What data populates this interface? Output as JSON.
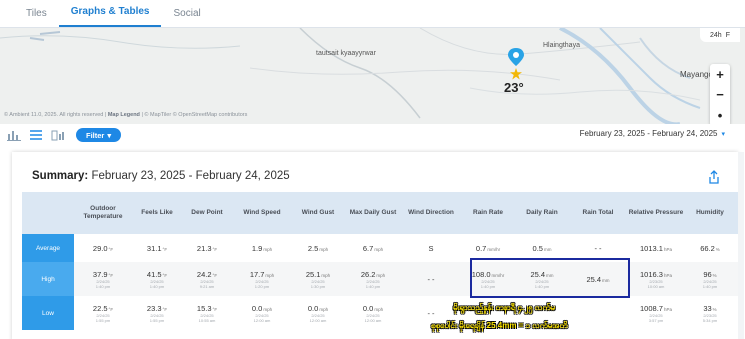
{
  "tabs": [
    {
      "label": "Tiles",
      "active": false
    },
    {
      "label": "Graphs & Tables",
      "active": true
    },
    {
      "label": "Social",
      "active": false
    }
  ],
  "map": {
    "labels": {
      "tautsait": "tautsait kyaayyrwar",
      "hlaingthaya": "Hlaingthaya",
      "mayangon": "Mayangc"
    },
    "temperature": "23°",
    "attribution_prefix": "© Ambient 11.0, 2025. All rights reserved |",
    "attribution_link": "Map Legend",
    "attribution_suffix": "| © MapTiler © OpenStreetMap contributors",
    "zoom_top": [
      "24h",
      "F"
    ],
    "zoom_controls": [
      "+",
      "−",
      "•"
    ]
  },
  "toolbar": {
    "filter_label": "Filter",
    "date_range": "February 23, 2025 - February 24, 2025"
  },
  "summary": {
    "title_bold": "Summary:",
    "title_rest": "February 23, 2025 - February 24, 2025"
  },
  "table": {
    "headers": [
      "",
      "Outdoor Temperature",
      "Feels Like",
      "Dew Point",
      "Wind Speed",
      "Wind Gust",
      "Max Daily Gust",
      "Wind Direction",
      "Rain Rate",
      "Daily Rain",
      "Rain Total",
      "Relative Pressure",
      "Humidity"
    ],
    "rows": [
      {
        "label": "Average",
        "cells": [
          {
            "value": "29.0",
            "unit": "°F"
          },
          {
            "value": "31.1",
            "unit": "°F"
          },
          {
            "value": "21.3",
            "unit": "°F"
          },
          {
            "value": "1.9",
            "unit": "mph"
          },
          {
            "value": "2.5",
            "unit": "mph"
          },
          {
            "value": "6.7",
            "unit": "mph"
          },
          {
            "value": "S",
            "unit": ""
          },
          {
            "value": "0.7",
            "unit": "mm/hr"
          },
          {
            "value": "0.5",
            "unit": "mm"
          },
          {
            "value": "- -",
            "unit": ""
          },
          {
            "value": "1013.1",
            "unit": "hPa"
          },
          {
            "value": "66.2",
            "unit": "%"
          }
        ]
      },
      {
        "label": "High",
        "cells": [
          {
            "value": "37.9",
            "unit": "°F",
            "d": "2/24/25",
            "t": "1:40 pm"
          },
          {
            "value": "41.5",
            "unit": "°F",
            "d": "2/24/25",
            "t": "1:40 pm"
          },
          {
            "value": "24.2",
            "unit": "°F",
            "d": "2/24/25",
            "t": "9:21 am"
          },
          {
            "value": "17.7",
            "unit": "mph",
            "d": "2/24/25",
            "t": "1:20 pm"
          },
          {
            "value": "25.1",
            "unit": "mph",
            "d": "2/24/25",
            "t": "1:30 pm"
          },
          {
            "value": "26.2",
            "unit": "mph",
            "d": "2/24/25",
            "t": "1:40 pm"
          },
          {
            "value": "- -",
            "unit": ""
          },
          {
            "value": "108.0",
            "unit": "mm/hr",
            "d": "2/24/25",
            "t": "1:40 pm"
          },
          {
            "value": "25.4",
            "unit": "mm",
            "d": "2/24/25",
            "t": "1:40 pm"
          },
          {
            "value": "25.4",
            "unit": "mm"
          },
          {
            "value": "1016.3",
            "unit": "hPa",
            "d": "2/23/25",
            "t": "10:00 am"
          },
          {
            "value": "96",
            "unit": "%",
            "d": "2/24/25",
            "t": "1:40 pm"
          }
        ]
      },
      {
        "label": "Low",
        "cells": [
          {
            "value": "22.5",
            "unit": "°F",
            "d": "2/24/25",
            "t": "1:55 pm"
          },
          {
            "value": "23.3",
            "unit": "°F",
            "d": "2/24/25",
            "t": "1:55 pm"
          },
          {
            "value": "15.3",
            "unit": "°F",
            "d": "2/24/25",
            "t": "10:55 am"
          },
          {
            "value": "0.0",
            "unit": "mph",
            "d": "2/24/25",
            "t": "12:00 am"
          },
          {
            "value": "0.0",
            "unit": "mph",
            "d": "2/24/25",
            "t": "12:00 am"
          },
          {
            "value": "0.0",
            "unit": "mph",
            "d": "2/24/25",
            "t": "12:00 am"
          },
          {
            "value": "- -",
            "unit": ""
          },
          {
            "value": "",
            "unit": ""
          },
          {
            "value": "",
            "unit": ""
          },
          {
            "value": "",
            "unit": ""
          },
          {
            "value": "1008.7",
            "unit": "hPa",
            "d": "2/24/25",
            "t": "3:57 pm"
          },
          {
            "value": "33",
            "unit": "%",
            "d": "2/23/25",
            "t": "5:34 pm"
          }
        ]
      }
    ]
  },
  "annotation": {
    "line1": "မိုးရွာသည့်နှုန်း တနာရီ ၄.၂၅ လက်မ",
    "line2": "စုစုပေါင်း မိုးရေချိန် 25.4mm = ၁ လက်မအတိ"
  },
  "colors": {
    "accent": "#1e88e5",
    "row_label_bg": "#2f9be8",
    "header_bg": "#dbe7f3",
    "highlight_box": "#1b2a9f",
    "annotation_text": "#ffe600"
  }
}
